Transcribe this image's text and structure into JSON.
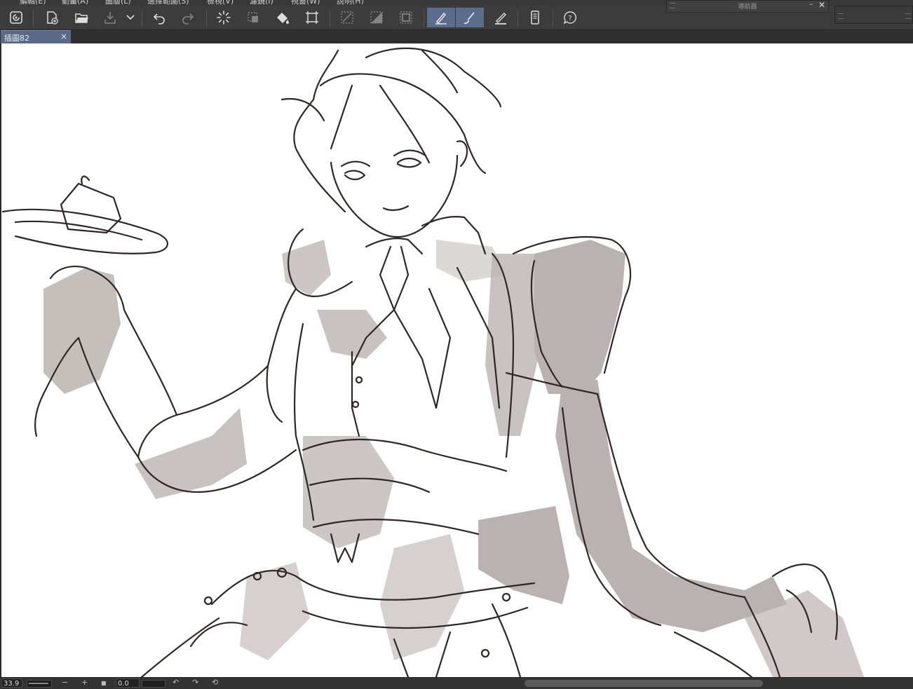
{
  "menu": {
    "items": [
      "編輯(E)",
      "動畫(A)",
      "圖層(L)",
      "選擇範圍(S)",
      "檢視(V)",
      "濾鏡(I)",
      "視窗(W)",
      "說明(H)"
    ]
  },
  "toolbar": {
    "icons": [
      "clip-studio-icon",
      "new-file-icon",
      "open-folder-icon",
      "save-icon",
      "dropdown-arrow-icon",
      "undo-icon",
      "redo-icon",
      "loading-spinner-icon",
      "transform-selection-icon",
      "fill-bucket-icon",
      "crop-icon",
      "clear-outside-icon",
      "fill-selection-icon",
      "border-selection-icon",
      "pen-pressure-icon",
      "brush-smooth-icon",
      "ruler-snap-icon",
      "smartphone-icon",
      "help-icon"
    ]
  },
  "navigator": {
    "title": "導航器",
    "minimize_label": "–",
    "close_label": "✕"
  },
  "tabs": [
    {
      "label": "插圖82",
      "close_label": "×"
    }
  ],
  "status_bar": {
    "zoom_value": "33.9",
    "zoom_out_label": "−",
    "zoom_in_label": "+",
    "fit_label": "■",
    "rotation_value": "0.0",
    "rotate_left_label": "↶",
    "rotate_right_label": "↷",
    "reset_rotation_label": "⟲"
  },
  "colors": {
    "toolbar_bg": "#3c3c3c",
    "active_tool": "#5b6d8c",
    "tab_active": "#5a6a86",
    "canvas": "#ffffff",
    "line_art": "#2f2626",
    "shading": "#b3aaa7"
  }
}
